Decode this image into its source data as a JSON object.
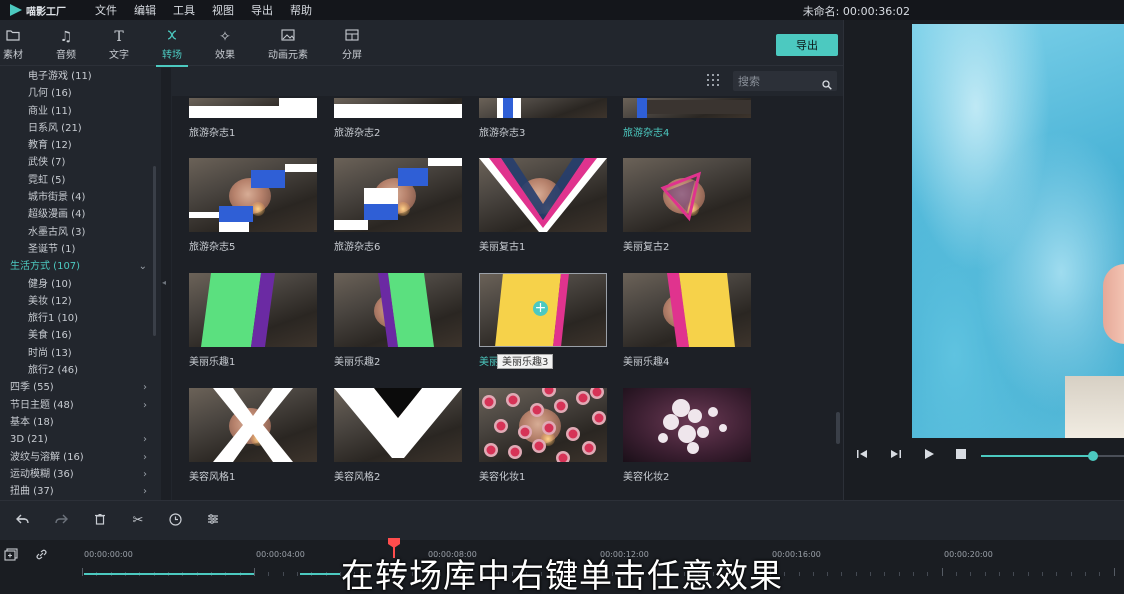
{
  "app": {
    "logo_text": "喵影工厂",
    "project_title": "未命名: 00:00:36:02"
  },
  "menu": [
    "文件",
    "编辑",
    "工具",
    "视图",
    "导出",
    "帮助"
  ],
  "toolbar": {
    "tabs": [
      {
        "label": "素材",
        "icon": "folder-icon"
      },
      {
        "label": "音频",
        "icon": "music-icon"
      },
      {
        "label": "文字",
        "icon": "text-icon"
      },
      {
        "label": "转场",
        "icon": "transition-icon",
        "active": true
      },
      {
        "label": "效果",
        "icon": "effects-icon"
      },
      {
        "label": "动画元素",
        "icon": "elements-icon"
      },
      {
        "label": "分屏",
        "icon": "splitscreen-icon"
      }
    ],
    "export_label": "导出"
  },
  "categories": [
    {
      "label": "电子游戏 (11)",
      "level": "sub"
    },
    {
      "label": "几何 (16)",
      "level": "sub"
    },
    {
      "label": "商业 (11)",
      "level": "sub"
    },
    {
      "label": "日系风 (21)",
      "level": "sub"
    },
    {
      "label": "教育 (12)",
      "level": "sub"
    },
    {
      "label": "武侠 (7)",
      "level": "sub"
    },
    {
      "label": "霓虹 (5)",
      "level": "sub"
    },
    {
      "label": "城市街景 (4)",
      "level": "sub"
    },
    {
      "label": "超级漫画 (4)",
      "level": "sub"
    },
    {
      "label": "水墨古风 (3)",
      "level": "sub"
    },
    {
      "label": "圣诞节 (1)",
      "level": "sub"
    },
    {
      "label": "生活方式 (107)",
      "level": "top",
      "selected": true,
      "chevron": "⌄"
    },
    {
      "label": "健身 (10)",
      "level": "sub"
    },
    {
      "label": "美妆 (12)",
      "level": "sub"
    },
    {
      "label": "旅行1 (10)",
      "level": "sub"
    },
    {
      "label": "美食 (16)",
      "level": "sub"
    },
    {
      "label": "时尚 (13)",
      "level": "sub"
    },
    {
      "label": "旅行2 (46)",
      "level": "sub"
    },
    {
      "label": "四季 (55)",
      "level": "top",
      "chevron": "›"
    },
    {
      "label": "节日主题 (48)",
      "level": "top",
      "chevron": "›"
    },
    {
      "label": "基本 (18)",
      "level": "top"
    },
    {
      "label": "3D (21)",
      "level": "top",
      "chevron": "›"
    },
    {
      "label": "波纹与溶解 (16)",
      "level": "top",
      "chevron": "›"
    },
    {
      "label": "运动模糊 (36)",
      "level": "top",
      "chevron": "›"
    },
    {
      "label": "扭曲 (37)",
      "level": "top",
      "chevron": "›"
    }
  ],
  "search": {
    "placeholder": "搜索"
  },
  "transitions": [
    {
      "label": "旅游杂志1",
      "style": "mag-top-a"
    },
    {
      "label": "旅游杂志2",
      "style": "mag-top-b"
    },
    {
      "label": "旅游杂志3",
      "style": "mag-top-c"
    },
    {
      "label": "旅游杂志4",
      "style": "mag-top-d",
      "highlight": true
    },
    {
      "label": "旅游杂志5",
      "style": "mag-blocks-a"
    },
    {
      "label": "旅游杂志6",
      "style": "mag-blocks-b"
    },
    {
      "label": "美丽复古1",
      "style": "retro-v"
    },
    {
      "label": "美丽复古2",
      "style": "retro-tri"
    },
    {
      "label": "美丽乐趣1",
      "style": "fun-green-a"
    },
    {
      "label": "美丽乐趣2",
      "style": "fun-green-b"
    },
    {
      "label": "美丽乐趣3",
      "style": "fun-yellow-a",
      "highlight": true,
      "hovered": true
    },
    {
      "label": "美丽乐趣4",
      "style": "fun-yellow-b"
    },
    {
      "label": "美容风格1",
      "style": "beauty-x"
    },
    {
      "label": "美容风格2",
      "style": "beauty-v"
    },
    {
      "label": "美容化妆1",
      "style": "makeup-circles"
    },
    {
      "label": "美容化妆2",
      "style": "makeup-blobs"
    }
  ],
  "tooltip": "美丽乐趣3",
  "preview": {
    "progress": 0.78
  },
  "timeline": {
    "timecodes": [
      "00:00:00:00",
      "00:00:04:00",
      "00:00:08:00",
      "00:00:12:00",
      "00:00:16:00",
      "00:00:20:00"
    ]
  },
  "subtitle": "在转场库中右键单击任意效果",
  "colors": {
    "accent": "#4cc9c0",
    "blue": "#2f5fd6",
    "green": "#5be07f",
    "yellow": "#f6d24a",
    "magenta": "#e0338e",
    "purple": "#6b2aa3"
  }
}
